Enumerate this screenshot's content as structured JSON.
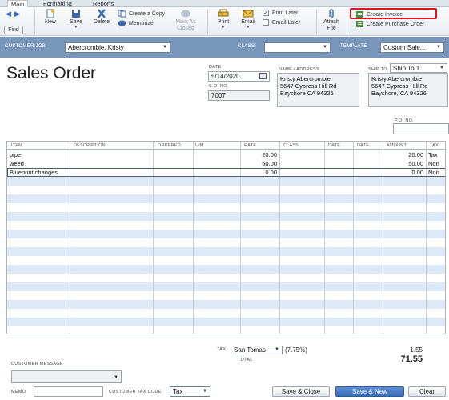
{
  "tabs": [
    {
      "label": "Main"
    },
    {
      "label": "Formatting"
    },
    {
      "label": "Reports"
    }
  ],
  "toolbar": {
    "find": "Find",
    "new": "New",
    "save": "Save",
    "delete": "Delete",
    "create_copy": "Create a Copy",
    "memorize": "Memorize",
    "mark_as_closed_1": "Mark As",
    "mark_as_closed_2": "Closed",
    "print": "Print",
    "email": "Email",
    "print_later": "Print Later",
    "email_later": "Email Later",
    "attach_1": "Attach",
    "attach_2": "File",
    "create_invoice": "Create Invoice",
    "create_purchase_order": "Create Purchase Order",
    "print_later_checked": true,
    "email_later_checked": false
  },
  "customer_bar": {
    "customer_job_label": "CUSTOMER:JOB",
    "customer_job_value": "Abercrombie, Kristy",
    "class_label": "CLASS",
    "class_value": "",
    "template_label": "TEMPLATE",
    "template_value": "Custom Sale..."
  },
  "form": {
    "title": "Sales Order",
    "date_label": "DATE",
    "date_value": "5/14/2020",
    "so_no_label": "S.O. NO.",
    "so_no_value": "7007",
    "name_address_label": "NAME / ADDRESS",
    "name_address_lines": [
      "Kristy Abercrombie",
      "5647 Cypress Hill Rd",
      "Bayshore CA 94326"
    ],
    "ship_to_label": "SHIP TO",
    "ship_to_value": "Ship To 1",
    "ship_to_lines": [
      "Kristy Abercrombie",
      "5647 Cypress Hill Rd",
      "Bayshore, CA 94326"
    ],
    "po_no_label": "P.O. NO.",
    "po_no_value": ""
  },
  "table": {
    "headers": {
      "item": "ITEM",
      "description": "DESCRIPTION",
      "ordered": "ORDERED",
      "um": "U/M",
      "rate": "RATE",
      "class": "CLASS",
      "date1": "DATE",
      "date2": "DATE",
      "amount": "AMOUNT",
      "tax": "TAX"
    },
    "rows": [
      {
        "item": "pipe",
        "rate": "20.00",
        "amount": "20.00",
        "tax": "Tax"
      },
      {
        "item": "weed",
        "rate": "50.00",
        "amount": "50.00",
        "tax": "Non"
      },
      {
        "item": "Blueprint changes",
        "rate": "0.00",
        "amount": "0.00",
        "tax": "Non"
      }
    ]
  },
  "footer": {
    "tax_label": "TAX",
    "tax_location": "San Tomas",
    "tax_rate": "(7.75%)",
    "tax_amount": "1.55",
    "total_label": "TOTAL",
    "total_amount": "71.55",
    "customer_message_label": "CUSTOMER MESSAGE",
    "memo_label": "MEMO",
    "memo_value": "",
    "customer_tax_code_label": "CUSTOMER TAX CODE",
    "customer_tax_code_value": "Tax",
    "save_close": "Save & Close",
    "save_new": "Save & New",
    "clear": "Clear"
  },
  "colors": {
    "customer_bar": "#7796b9",
    "highlight_outline": "#e0141b",
    "stripe": "#dde9f7",
    "primary_button": "#3a6bb5"
  }
}
